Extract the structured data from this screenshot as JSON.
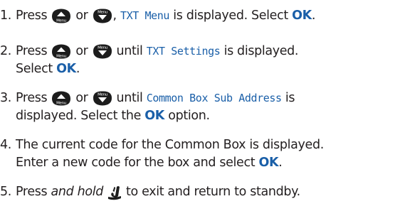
{
  "icons": {
    "up_key": "up-menu-key-icon",
    "down_key": "down-menu-key-icon",
    "end_key": "end-call-key-icon"
  },
  "colors": {
    "text": "#231f20",
    "accent": "#1a5fa8",
    "key_fill": "#1c1c1c"
  },
  "key_caption": "Menu",
  "steps": [
    {
      "num": "1.",
      "press": "Press",
      "or": "or",
      "sep": ",",
      "display": "TXT Menu",
      "rest": "is displayed. Select",
      "ok": "OK",
      "end": "."
    },
    {
      "num": "2.",
      "press": "Press",
      "or": "or",
      "until": "until",
      "display": "TXT Settings",
      "rest": "is displayed.",
      "select": "Select",
      "ok": "OK",
      "end": "."
    },
    {
      "num": "3.",
      "press": "Press",
      "or": "or",
      "until": "until",
      "display": "Common Box Sub Address",
      "is": "is",
      "rest": "displayed. Select the",
      "ok": "OK",
      "end": "option."
    },
    {
      "num": "4.",
      "line1": "The current code for the Common Box is displayed.",
      "line2": "Enter a new code for the box and select",
      "ok": "OK",
      "end": "."
    },
    {
      "num": "5.",
      "press": "Press",
      "em": "and hold",
      "end": "to exit and return to standby."
    }
  ]
}
